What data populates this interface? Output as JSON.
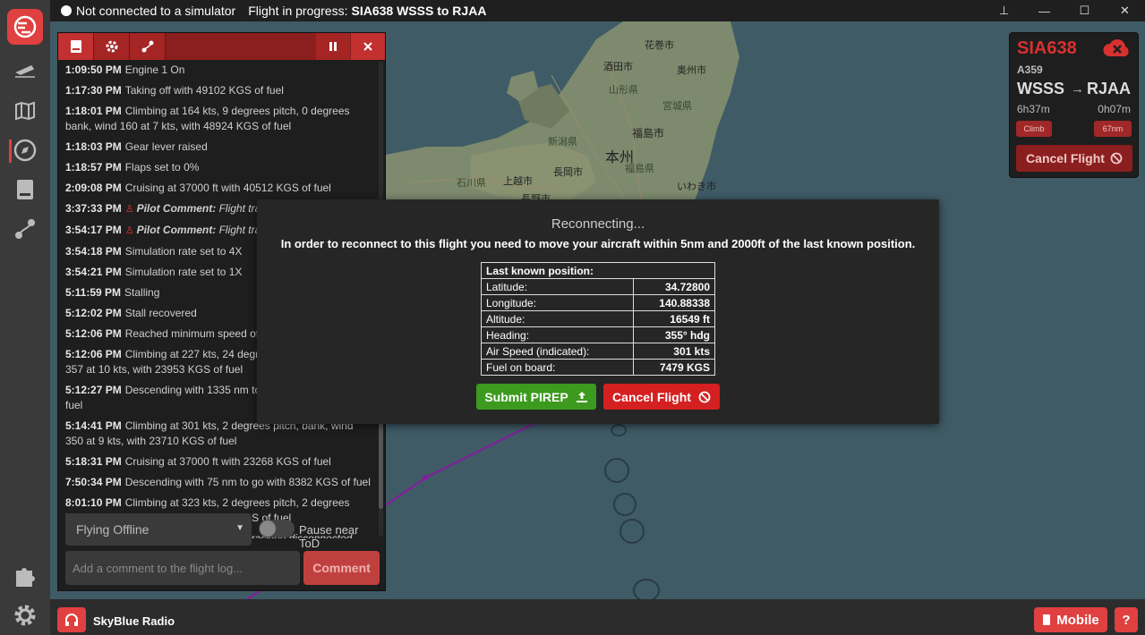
{
  "titlebar": {
    "sim_status": "Not connected to a simulator",
    "flight_prefix": "Flight in progress:",
    "flight_desc": "SIA638 WSSS to RJAA",
    "ctrl_pin": "⊥",
    "ctrl_min": "—",
    "ctrl_max": "☐",
    "ctrl_close": "✕"
  },
  "sidebar": {
    "items": [
      "logo-icon",
      "departures-icon",
      "map-icon",
      "compass-icon",
      "logbook-icon",
      "route-icon"
    ],
    "bottom": [
      "puzzle-icon",
      "gear-icon"
    ]
  },
  "map_labels": [
    {
      "text": "花巻市"
    },
    {
      "text": "酒田市"
    },
    {
      "text": "奥州市"
    },
    {
      "text": "山形県"
    },
    {
      "text": "宮城県"
    },
    {
      "text": "新潟県"
    },
    {
      "text": "福島市"
    },
    {
      "text": "本州"
    },
    {
      "text": "福島県"
    },
    {
      "text": "長岡市"
    },
    {
      "text": "石川県"
    },
    {
      "text": "上越市"
    },
    {
      "text": "いわき市"
    },
    {
      "text": "長野市"
    }
  ],
  "log": {
    "entries": [
      {
        "time": "1:09:50 PM",
        "text": "Engine 1 On"
      },
      {
        "time": "1:17:30 PM",
        "text": "Taking off with 49102 KGS of fuel"
      },
      {
        "time": "1:18:01 PM",
        "text": "Climbing at 164 kts, 9 degrees pitch, 0 degrees bank, wind 160 at 7 kts, with 48924 KGS of fuel"
      },
      {
        "time": "1:18:03 PM",
        "text": "Gear lever raised"
      },
      {
        "time": "1:18:57 PM",
        "text": "Flaps set to 0%"
      },
      {
        "time": "2:09:08 PM",
        "text": "Cruising at 37000 ft with 40512 KGS of fuel"
      },
      {
        "time": "3:37:33 PM",
        "pilot": "Pilot Comment:",
        "text": "Flight tracking disconnected"
      },
      {
        "time": "3:54:17 PM",
        "pilot": "Pilot Comment:",
        "text": "Flight tracking reconnected"
      },
      {
        "time": "3:54:18 PM",
        "text": "Simulation rate set to 4X"
      },
      {
        "time": "3:54:21 PM",
        "text": "Simulation rate set to 1X"
      },
      {
        "time": "5:11:59 PM",
        "text": "Stalling"
      },
      {
        "time": "5:12:02 PM",
        "text": "Stall recovered"
      },
      {
        "time": "5:12:06 PM",
        "text": "Reached minimum speed of"
      },
      {
        "time": "5:12:06 PM",
        "text": "Climbing at 227 kts, 24 degrees pitch, bank, wind 357 at 10 kts, with 23953 KGS of fuel"
      },
      {
        "time": "5:12:27 PM",
        "text": "Descending with 1335 nm to go with 23800 KGS of fuel"
      },
      {
        "time": "5:14:41 PM",
        "text": "Climbing at 301 kts, 2 degrees pitch, bank, wind 350 at 9 kts, with 23710 KGS of fuel"
      },
      {
        "time": "5:18:31 PM",
        "text": "Cruising at 37000 ft with 23268 KGS of fuel"
      },
      {
        "time": "7:50:34 PM",
        "text": "Descending with 75 nm to go with 8382 KGS of fuel"
      },
      {
        "time": "8:01:10 PM",
        "text": "Climbing at 323 kts, 2 degrees pitch, 2 degrees bank, wind 037 at 60 kts, with 7479 KGS of fuel"
      },
      {
        "time": "8:01:29 PM",
        "pilot": "Pilot Comment:",
        "text": "Flight tracking disconnected"
      }
    ],
    "mode_select": "Flying Offline",
    "pause_label": "Pause near ToD",
    "comment_placeholder": "Add a comment to the flight log...",
    "comment_button": "Comment"
  },
  "flight_card": {
    "callsign": "SIA638",
    "aircraft": "A359",
    "departure": "WSSS",
    "arrival": "RJAA",
    "elapsed": "6h37m",
    "remaining": "0h07m",
    "phase_badge": "Climb",
    "distance_badge": "67nm",
    "cancel_label": "Cancel Flight"
  },
  "modal": {
    "title": "Reconnecting...",
    "message": "In order to reconnect to this flight you need to move your aircraft within 5nm and 2000ft of the last known position.",
    "table_header": "Last known position:",
    "rows": [
      {
        "label": "Latitude:",
        "value": "34.72800"
      },
      {
        "label": "Longitude:",
        "value": "140.88338"
      },
      {
        "label": "Altitude:",
        "value": "16549 ft"
      },
      {
        "label": "Heading:",
        "value": "355° hdg"
      },
      {
        "label": "Air Speed (indicated):",
        "value": "301 kts"
      },
      {
        "label": "Fuel on board:",
        "value": "7479 KGS"
      }
    ],
    "submit_label": "Submit PIREP",
    "cancel_label": "Cancel Flight"
  },
  "bottombar": {
    "radio_label": "SkyBlue Radio",
    "mobile_label": "Mobile",
    "help_label": "?"
  },
  "colors": {
    "accent": "#e04040",
    "map_sea": "#3f5b66",
    "map_land": "#7c8770",
    "submit": "#3c9a1e",
    "cancel": "#d42020"
  }
}
